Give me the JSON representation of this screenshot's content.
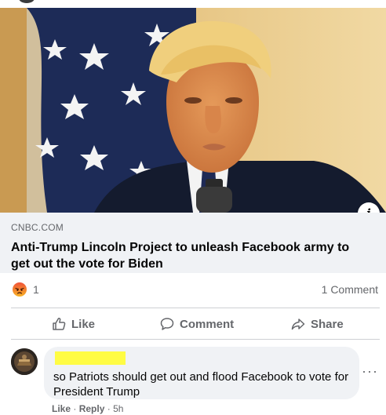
{
  "link_preview": {
    "source": "CNBC.COM",
    "headline": "Anti-Trump Lincoln Project to unleash Facebook army to get out the vote for Biden",
    "info_glyph": "i"
  },
  "reactions": {
    "reaction_icon": "angry-reaction",
    "count": "1",
    "comments": "1 Comment"
  },
  "actions": {
    "like": "Like",
    "comment": "Comment",
    "share": "Share"
  },
  "comment": {
    "text": "so Patriots should get out and flood Facebook to vote for President Trump",
    "like": "Like",
    "sep1": "·",
    "reply": "Reply",
    "sep2": "·",
    "time": "5h",
    "more": "···"
  },
  "colors": {
    "meta_bg": "#f0f2f5",
    "secondary_text": "#65676b",
    "redaction": "#fffc44"
  }
}
